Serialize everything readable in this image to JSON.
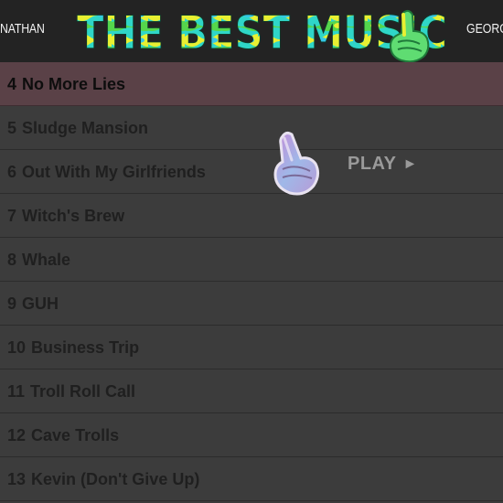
{
  "header": {
    "nav_left": "NATHAN",
    "logo_text": "THE BEST MUSIC",
    "nav_right": "GEORGE"
  },
  "tracks": [
    {
      "number": "4",
      "title": "No More Lies"
    },
    {
      "number": "5",
      "title": "Sludge Mansion"
    },
    {
      "number": "6",
      "title": "Out With My Girlfriends"
    },
    {
      "number": "7",
      "title": "Witch's Brew"
    },
    {
      "number": "8",
      "title": "Whale"
    },
    {
      "number": "9",
      "title": "GUH"
    },
    {
      "number": "10",
      "title": "Business Trip"
    },
    {
      "number": "11",
      "title": "Troll Roll Call"
    },
    {
      "number": "12",
      "title": "Cave Trolls"
    },
    {
      "number": "13",
      "title": "Kevin (Don't Give Up)"
    }
  ],
  "active_track_index": 0,
  "play_overlay": {
    "label": "PLAY",
    "arrow": "►",
    "icon": "pointing-hand-icon"
  },
  "colors": {
    "header_bg": "#232323",
    "list_bg": "#3c3c3c",
    "active_row_bg": "#5a4147",
    "logo_green": "#3fd16a",
    "logo_yellow": "#e7ef2f",
    "logo_cyan": "#2fd9e0"
  }
}
